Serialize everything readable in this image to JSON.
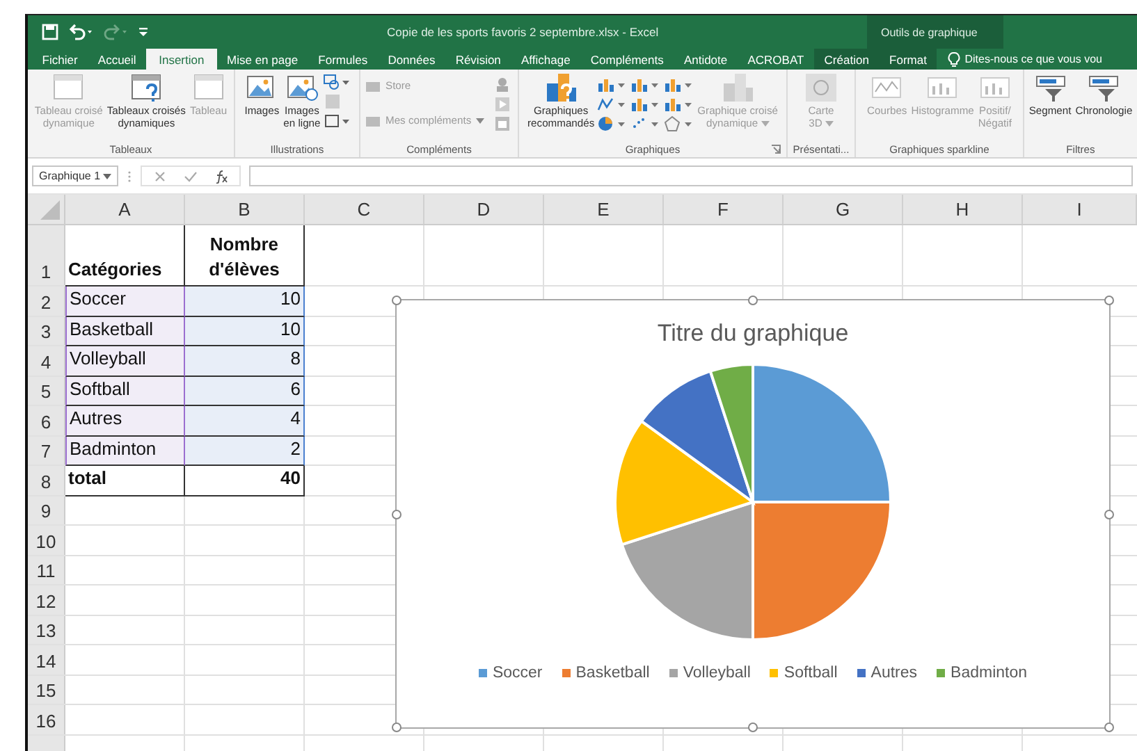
{
  "title_bar": {
    "title": "Copie de les sports favoris 2 septembre.xlsx - Excel",
    "context_label": "Outils de graphique"
  },
  "tabs": [
    {
      "label": "Fichier",
      "selected": false,
      "kind": "normal"
    },
    {
      "label": "Accueil",
      "selected": false,
      "kind": "normal"
    },
    {
      "label": "Insertion",
      "selected": true,
      "kind": "normal"
    },
    {
      "label": "Mise en page",
      "selected": false,
      "kind": "normal"
    },
    {
      "label": "Formules",
      "selected": false,
      "kind": "normal"
    },
    {
      "label": "Données",
      "selected": false,
      "kind": "normal"
    },
    {
      "label": "Révision",
      "selected": false,
      "kind": "normal"
    },
    {
      "label": "Affichage",
      "selected": false,
      "kind": "normal"
    },
    {
      "label": "Compléments",
      "selected": false,
      "kind": "normal"
    },
    {
      "label": "Antidote",
      "selected": false,
      "kind": "normal"
    },
    {
      "label": "ACROBAT",
      "selected": false,
      "kind": "normal"
    },
    {
      "label": "Création",
      "selected": false,
      "kind": "contextual"
    },
    {
      "label": "Format",
      "selected": false,
      "kind": "contextual"
    }
  ],
  "tell_me": {
    "placeholder": "Dites-nous ce que vous vou"
  },
  "ribbon": {
    "groups": [
      {
        "label": "Tableaux",
        "items": [
          {
            "label": "Tableau croisé\ndynamique",
            "disabled": true,
            "kind": "large",
            "dropdown": false
          },
          {
            "label": "Tableaux croisés\ndynamiques",
            "disabled": false,
            "kind": "large",
            "dropdown": false
          },
          {
            "label": "Tableau",
            "disabled": true,
            "kind": "large",
            "dropdown": false
          }
        ]
      },
      {
        "label": "Illustrations",
        "items": [
          {
            "label": "Images",
            "disabled": false,
            "kind": "large",
            "dropdown": false
          },
          {
            "label": "Images\nen ligne",
            "disabled": false,
            "kind": "large",
            "dropdown": false
          }
        ]
      },
      {
        "label": "Compléments",
        "items": [
          {
            "label": "Store",
            "disabled": true,
            "kind": "small",
            "dropdown": false
          },
          {
            "label": "Mes compléments",
            "disabled": true,
            "kind": "small",
            "dropdown": true
          }
        ]
      },
      {
        "label": "Graphiques",
        "items": [
          {
            "label": "Graphiques\nrecommandés",
            "disabled": false,
            "kind": "large",
            "dropdown": false
          },
          {
            "label": "Graphique croisé\ndynamique",
            "disabled": true,
            "kind": "large",
            "dropdown": true
          }
        ]
      },
      {
        "label": "Présentati...",
        "items": [
          {
            "label": "Carte\n3D",
            "disabled": true,
            "kind": "large",
            "dropdown": true
          }
        ]
      },
      {
        "label": "Graphiques sparkline",
        "items": [
          {
            "label": "Courbes",
            "disabled": true,
            "kind": "large",
            "dropdown": false
          },
          {
            "label": "Histogramme",
            "disabled": true,
            "kind": "large",
            "dropdown": false
          },
          {
            "label": "Positif/\nNégatif",
            "disabled": true,
            "kind": "large",
            "dropdown": false
          }
        ]
      },
      {
        "label": "Filtres",
        "items": [
          {
            "label": "Segment",
            "disabled": false,
            "kind": "large",
            "dropdown": false
          },
          {
            "label": "Chronologie",
            "disabled": false,
            "kind": "large",
            "dropdown": false
          }
        ]
      }
    ]
  },
  "formula_bar": {
    "name_box": "Graphique 1"
  },
  "sheet": {
    "columns": [
      "A",
      "B",
      "C",
      "D",
      "E",
      "F",
      "G",
      "H",
      "I"
    ],
    "rows": [
      {
        "number": "1",
        "a": "Catégories",
        "b": "Nombre\nd'élèves",
        "bold": true,
        "highlight": false
      },
      {
        "number": "2",
        "a": "Soccer",
        "b": "10",
        "bold": false,
        "highlight": true
      },
      {
        "number": "3",
        "a": "Basketball",
        "b": "10",
        "bold": false,
        "highlight": true
      },
      {
        "number": "4",
        "a": "Volleyball",
        "b": "8",
        "bold": false,
        "highlight": true
      },
      {
        "number": "5",
        "a": "Softball",
        "b": "6",
        "bold": false,
        "highlight": true
      },
      {
        "number": "6",
        "a": "Autres",
        "b": "4",
        "bold": false,
        "highlight": true
      },
      {
        "number": "7",
        "a": "Badminton",
        "b": "2",
        "bold": false,
        "highlight": true
      },
      {
        "number": "8",
        "a": "total",
        "b": "40",
        "bold": true,
        "highlight": false
      },
      {
        "number": "9"
      },
      {
        "number": "10"
      },
      {
        "number": "11"
      },
      {
        "number": "12"
      },
      {
        "number": "13"
      },
      {
        "number": "14"
      },
      {
        "number": "15"
      },
      {
        "number": "16"
      }
    ]
  },
  "chart": {
    "chart_data": {
      "type": "pie",
      "title": "Titre du graphique",
      "categories": [
        "Soccer",
        "Basketball",
        "Volleyball",
        "Softball",
        "Autres",
        "Badminton"
      ],
      "values": [
        25,
        25,
        20,
        15,
        10,
        5
      ],
      "legend": "bottom"
    }
  }
}
